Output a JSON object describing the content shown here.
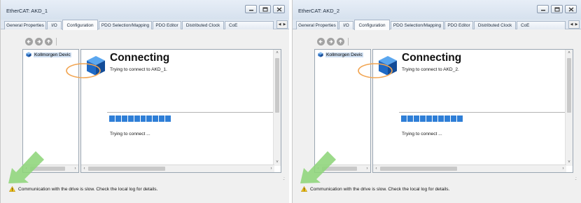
{
  "colors": {
    "accent": "#2f7fd7",
    "tab_bar": "#dfe7f1",
    "highlight_ellipse": "#f2a552",
    "annotation_arrow": "#8ed57a",
    "warning_icon": "#f5c518"
  },
  "panels": [
    {
      "window_title": "EtherCAT: AKD_1",
      "tabs": [
        {
          "label": "General Properties",
          "active": false
        },
        {
          "label": "I/O",
          "active": false
        },
        {
          "label": "Configuration",
          "active": true
        },
        {
          "label": "PDO Selection/Mapping",
          "active": false
        },
        {
          "label": "PDO Editor",
          "active": false
        },
        {
          "label": "Distributed Clock",
          "active": false
        },
        {
          "label": "CoE",
          "active": false
        }
      ],
      "tree_item": "Kollmorgen Devic",
      "heading": "Connecting",
      "subtext": "Trying to connect to AKD_1.",
      "progress_segments": 10,
      "status_text": "Trying to connect ...",
      "warning": "Communication with the drive is slow. Check the local log for details."
    },
    {
      "window_title": "EtherCAT: AKD_2",
      "tabs": [
        {
          "label": "General Properties",
          "active": false
        },
        {
          "label": "I/O",
          "active": false
        },
        {
          "label": "Configuration",
          "active": true
        },
        {
          "label": "PDO Selection/Mapping",
          "active": false
        },
        {
          "label": "PDO Editor",
          "active": false
        },
        {
          "label": "Distributed Clock",
          "active": false
        },
        {
          "label": "CoE",
          "active": false
        }
      ],
      "tree_item": "Kollmorgen Devic",
      "heading": "Connecting",
      "subtext": "Trying to connect to AKD_2.",
      "progress_segments": 10,
      "status_text": "Trying to connect ...",
      "warning": "Communication with the drive is slow. Check the local log for details."
    }
  ],
  "icons": {
    "nav_back": "back-arrow-icon",
    "nav_forward": "forward-arrow-icon",
    "nav_up": "up-arrow-icon",
    "minimize": "minimize-icon",
    "maximize": "maximize-icon",
    "close": "close-icon",
    "cube": "blue-cube-icon",
    "warning": "warning-triangle-icon"
  }
}
